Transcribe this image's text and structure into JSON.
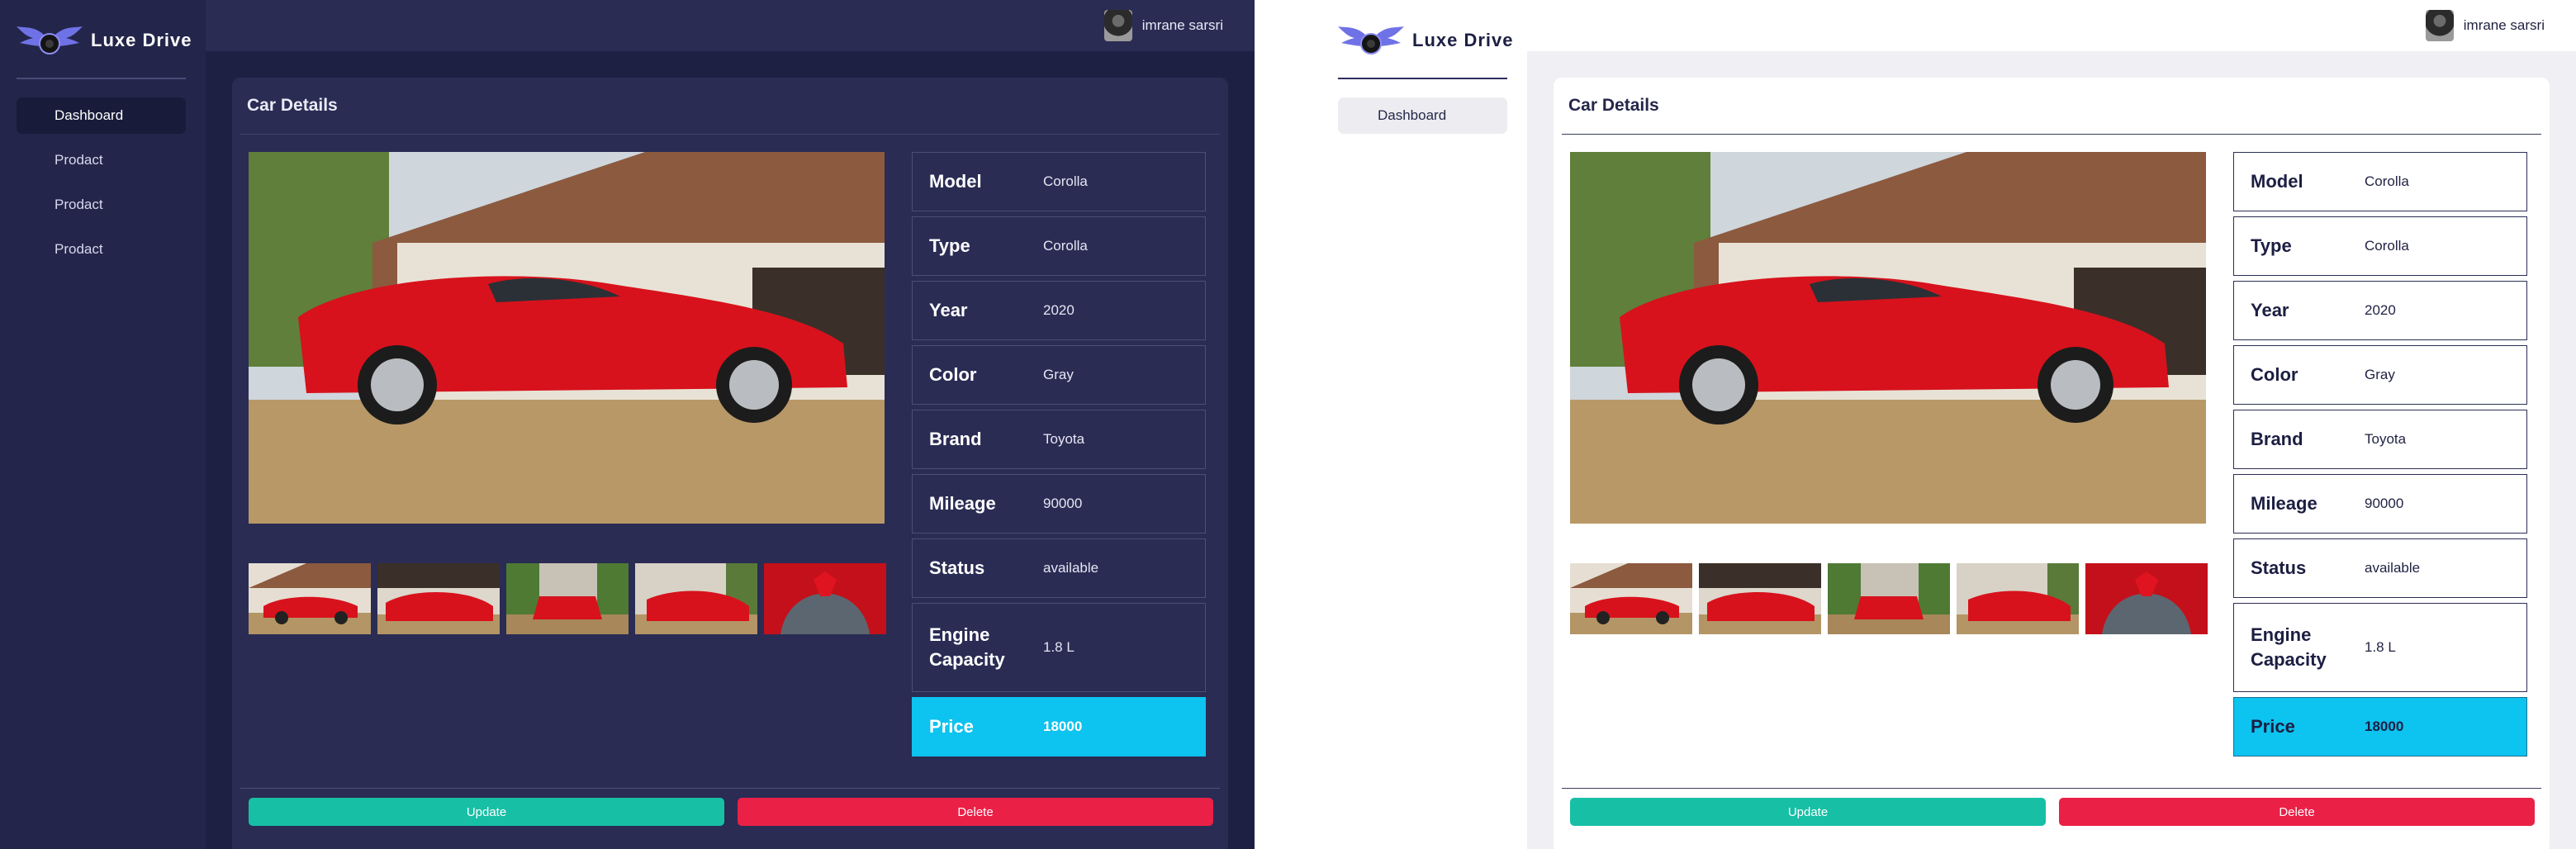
{
  "app": {
    "brand": "Luxe  Drive"
  },
  "user": {
    "name": "imrane sarsri"
  },
  "sidebar": {
    "items": [
      {
        "label": "Dashboard"
      },
      {
        "label": "Prodact"
      },
      {
        "label": "Prodact"
      },
      {
        "label": "Prodact"
      }
    ]
  },
  "card": {
    "title": "Car Details",
    "specs": [
      {
        "label": "Model",
        "value": "Corolla"
      },
      {
        "label": "Type",
        "value": "Corolla"
      },
      {
        "label": "Year",
        "value": "2020"
      },
      {
        "label": "Color",
        "value": "Gray"
      },
      {
        "label": "Brand",
        "value": "Toyota"
      },
      {
        "label": "Mileage",
        "value": "90000"
      },
      {
        "label": "Status",
        "value": "available"
      },
      {
        "label": "Engine Capacity",
        "value": "1.8 L"
      },
      {
        "label": "Price",
        "value": "18000"
      }
    ],
    "update_label": "Update",
    "delete_label": "Delete"
  },
  "colors": {
    "dark_bg": "#1e2043",
    "dark_card": "#2a2c54",
    "accent_price": "#0dc3ef",
    "update": "#17bfa5",
    "delete": "#ea2047"
  }
}
